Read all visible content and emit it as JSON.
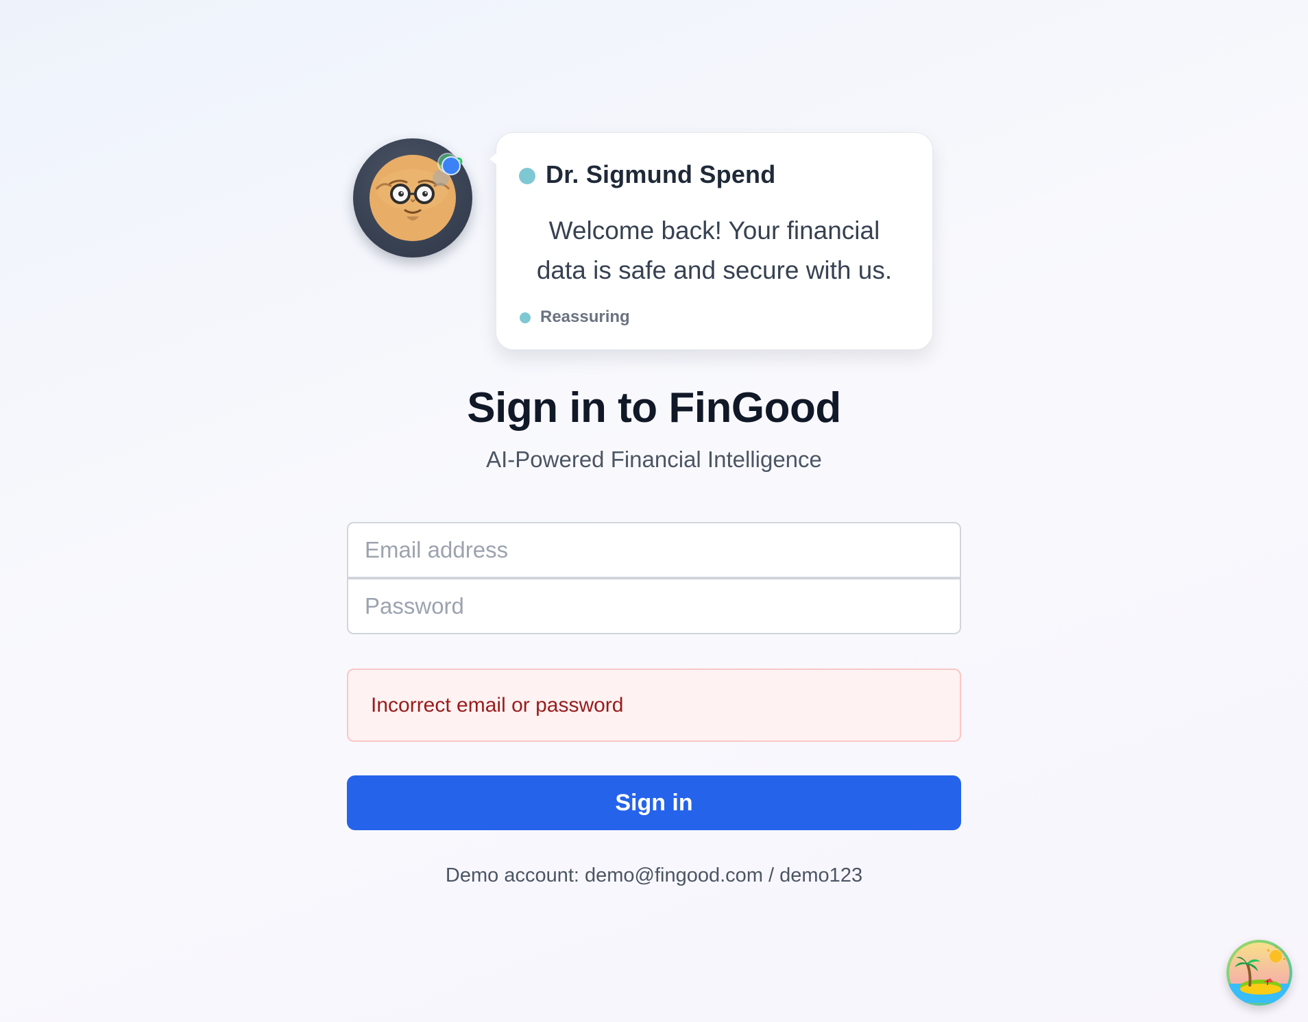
{
  "advisor": {
    "name": "Dr. Sigmund Spend",
    "message": "Welcome back! Your financial data is safe and secure with us.",
    "mood": "Reassuring",
    "accent_color": "#7ec8d3",
    "avatar_icon": "advisor-avatar-icon"
  },
  "login": {
    "title": "Sign in to FinGood",
    "subtitle": "AI-Powered Financial Intelligence",
    "email_placeholder": "Email address",
    "password_placeholder": "Password",
    "email_value": "",
    "password_value": "",
    "error_message": "Incorrect email or password",
    "submit_label": "Sign in",
    "demo_note": "Demo account: demo@fingood.com / demo123"
  },
  "colors": {
    "primary": "#2563eb",
    "error_text": "#991b1b",
    "error_bg": "#fef2f2",
    "error_border": "#fbc6c6"
  },
  "floating_action": {
    "icon": "vacation-island-icon"
  }
}
